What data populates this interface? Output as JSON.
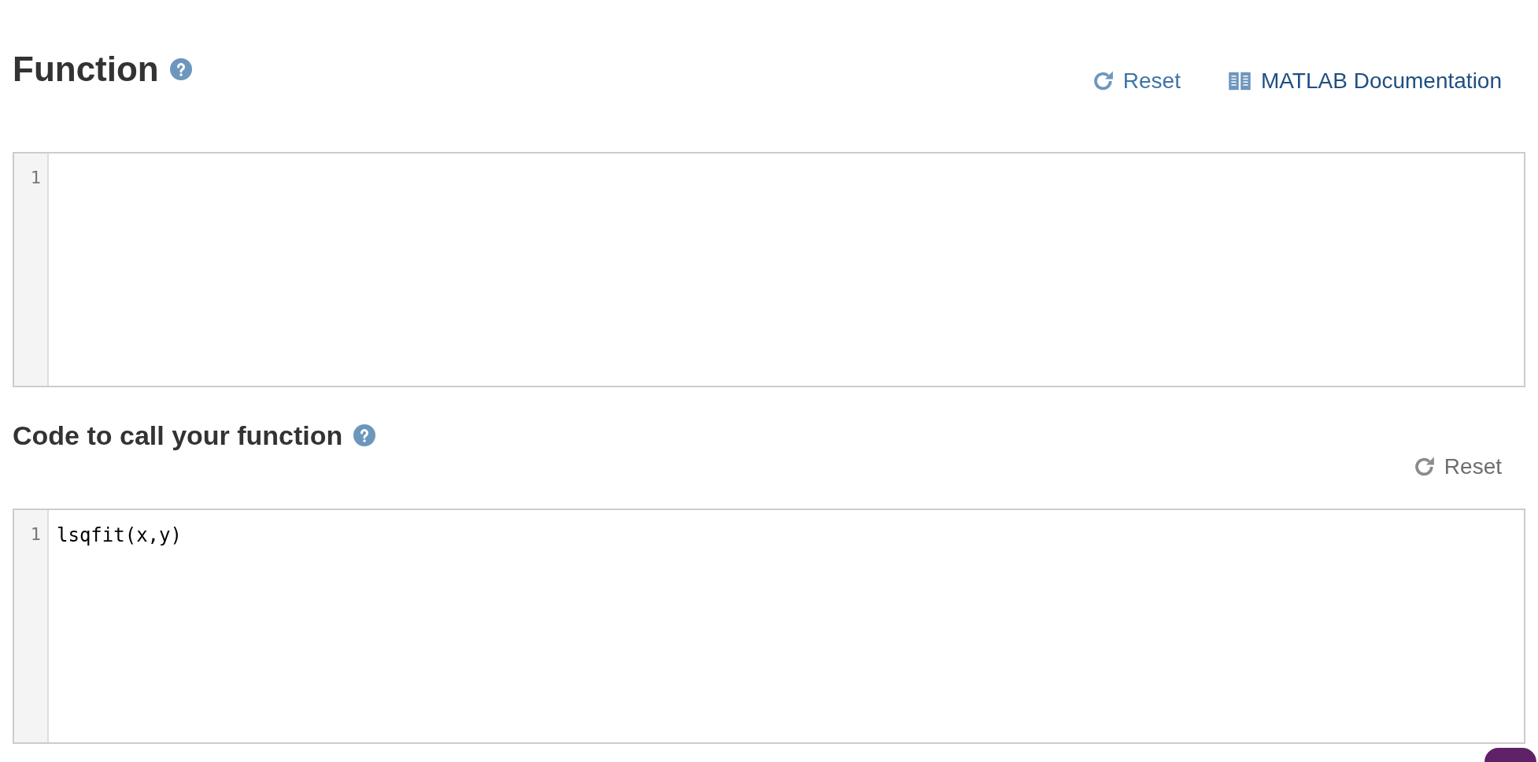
{
  "sections": [
    {
      "title": "Function",
      "help": true,
      "reset": {
        "label": "Reset",
        "disabled": false
      },
      "doc_link": {
        "label": "MATLAB Documentation"
      },
      "editor": {
        "lines": [
          {
            "number": "1"
          }
        ]
      }
    },
    {
      "title": "Code to call your function",
      "help": true,
      "reset": {
        "label": "Reset",
        "disabled": true
      },
      "editor": {
        "lines": [
          {
            "number": "1",
            "code": "lsqfit(x,y)"
          }
        ]
      }
    }
  ]
}
